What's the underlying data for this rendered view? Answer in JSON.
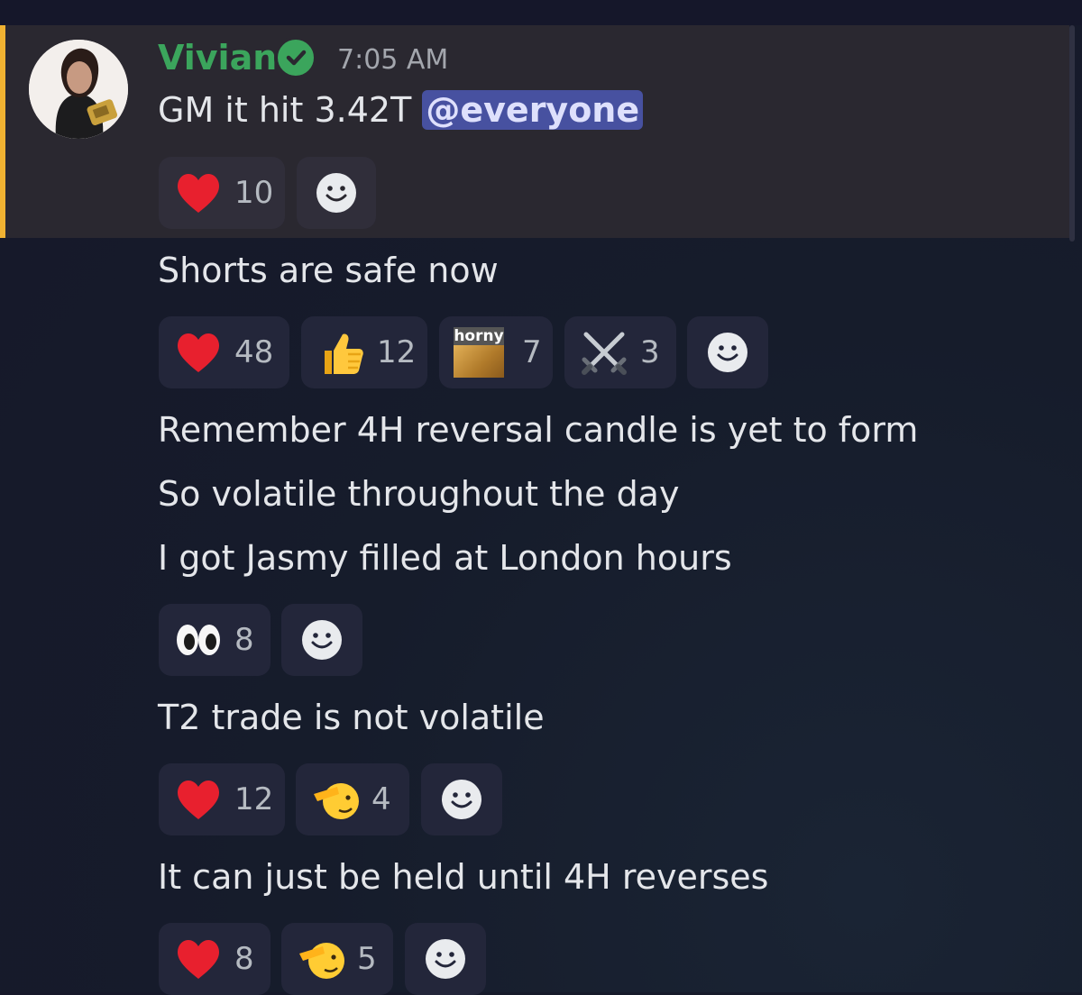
{
  "message": {
    "author": "Vivian",
    "time": "7:05 AM",
    "first_line": "GM it hit 3.42T ",
    "mention": "@everyone"
  },
  "lines": [
    "Shorts are safe now",
    "Remember 4H reversal candle is yet to form",
    "So volatile throughout the day",
    "I got Jasmy filled at London hours",
    "T2 trade is not volatile",
    "It can just be held until 4H reverses"
  ],
  "reactions": {
    "row1": [
      {
        "icon": "heart-icon",
        "count": "10"
      }
    ],
    "row2": [
      {
        "icon": "heart-icon",
        "count": "48"
      },
      {
        "icon": "thumbs-up-icon",
        "count": "12"
      },
      {
        "icon": "horny-doge-emote",
        "label": "horny",
        "count": "7"
      },
      {
        "icon": "crossed-swords-icon",
        "count": "3"
      }
    ],
    "row3": [
      {
        "icon": "eyes-icon",
        "count": "8"
      }
    ],
    "row4": [
      {
        "icon": "heart-icon",
        "count": "12"
      },
      {
        "icon": "saluting-face-icon",
        "count": "4"
      }
    ],
    "row5": [
      {
        "icon": "heart-icon",
        "count": "8"
      },
      {
        "icon": "saluting-face-icon",
        "count": "5"
      }
    ]
  },
  "colors": {
    "username": "#3ba55c",
    "mention_bg": "#4751a0",
    "highlight_bar": "#f0b232",
    "heart": "#e8202e"
  }
}
